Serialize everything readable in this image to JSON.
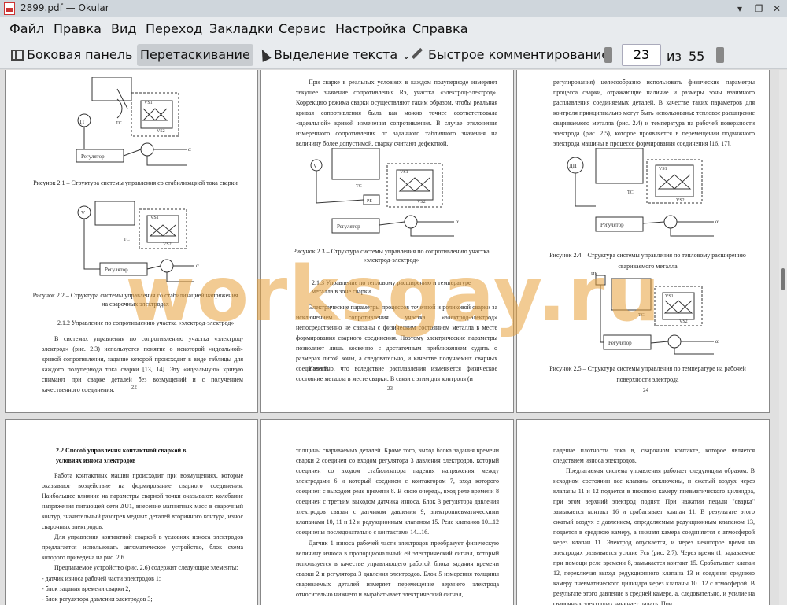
{
  "window": {
    "title": "2899.pdf — Okular",
    "controls": [
      "▾",
      "❐",
      "✕"
    ]
  },
  "menu": [
    "Файл",
    "Правка",
    "Вид",
    "Переход",
    "Закладки",
    "Сервис",
    "Настройка",
    "Справка"
  ],
  "toolbar": {
    "sidebar_label": "Боковая панель",
    "drag_label": "Перетаскивание",
    "select_label": "Выделение текста",
    "select_arrow": "⌄",
    "comment_label": "Быстрое комментирование",
    "current_page": "23",
    "of_label": "из",
    "total_pages": "55"
  },
  "watermark": "worksgay.ru",
  "pages": {
    "p22": {
      "fig21_caption": "Рисунок 2.1 – Структура системы управления со стабилизацией тока сварки",
      "fig22_caption": "Рисунок 2.2 – Структура системы управления со стабилизацией напряжения на сварочных электродах",
      "section": "2.1.2 Управление по сопротивлению участка «электрод-электрод»",
      "para": "В системах управления по сопротивлению участка «электрод-электрод» (рис. 2.3) используется понятие о некоторой «идеальной» кривой сопротивления, задание которой происходит в виде таблицы для каждого полупериода тока сварки [13, 14]. Эту «идеальную» кривую снимают при сварке деталей без возмущений и с получением качественного соединения.",
      "num": "22"
    },
    "p23": {
      "para1": "При сварке в реальных условиях в каждом полупериоде измеряют текущее значение сопротивления Rэ, участка «электрод-электрод». Коррекцию режима сварки осуществляют таким образом, чтобы реальная кривая сопротивления была как можно точнее соответствовала «идеальной» кривой изменения сопротивления. В случае отклонения измеренного сопротивления от заданного табличного значения на величину более допустимой, сварку считают дефектной.",
      "fig23_caption": "Рисунок 2.3 – Структура системы управления по сопротивлению участка «электрод-электрод»",
      "section": "2.1.3 Управление по тепловому расширению и температуре металла в зоне сварки",
      "para2": "Электрические параметры процессов точечной и роликовой сварки за исключением сопротивления участка «электрод-электрод» непосредственно не связаны с физическим состоянием металла в месте формирования сварного соединения. Поэтому электрические параметры позволяют лишь косвенно с достаточным приближением судить о размерах литой зоны, а следовательно, и качестве получаемых сварных соединений.",
      "para3": "Известно, что вследствие расплавления изменяется физическое состояние металла в месте сварки. В связи с этим для контроля (и",
      "num": "23"
    },
    "p24": {
      "para1": "регулирования) целесообразно использовать физические параметры процесса сварки, отражающие наличие и размеры зоны взаимного расплавления соединяемых деталей. В качестве таких параметров для контроля принципиально могут быть использованы: тепловое расширение свариваемого металла (рис. 2.4) и температура на рабочей поверхности электрода (рис. 2.5), которое проявляется в перемещении подвижного электрода машины в процессе формирования соединения [16, 17].",
      "fig24_caption": "Рисунок 2.4 – Структура системы управления по тепловому расширению свариваемого металла",
      "fig25_caption": "Рисунок 2.5 – Структура системы управления по температуре на рабочей поверхности электрода",
      "num": "24"
    },
    "p25": {
      "heading": "2.2 Способ управления контактной сваркой в условиях износа электродов",
      "para1": "Работа контактных машин происходит при возмущениях, которые оказывают воздействие на формирование сварного соединения. Наибольшее влияние на параметры сварной точки оказывают: колебание напряжения питающей сети ΔU1, внесение магнитных масс в сварочный контур, значительный разогрев медных деталей вторичного контура, износ сварочных электродов.",
      "para2": "Для управления контактной сваркой в условиях износа электродов предлагается использовать автоматическое устройство, блок схема которого приведена на рис. 2.6.",
      "para3": "Предлагаемое устройство (рис. 2.6) содержит следующие элементы:",
      "list": [
        "- датчик износа рабочей части электродов 1;",
        "- блок задания времени сварки 2;",
        "- блок регулятора давления электродов 3;"
      ]
    },
    "p26": {
      "para1": "толщины свариваемых деталей. Кроме того, выход блока задания времени сварки 2 соединен со входом регулятора 3 давления электродов, который соединен со входом стабилизатора падения напряжения между электродами 6 и который соединен с контактором 7, вход которого соединен с выходом реле времени 8. В свою очередь, вход реле времени 8 соединен с третьим выходом датчика износа. Блок 3 регулятора давления электродов связан с датчиком давления 9, электропневматическими клапанами 10, 11 и 12 и редукционным клапаном 15. Реле клапанов 10...12 соединены последовательно с контактами 14...16.",
      "para2": "Датчик 1 износа рабочей части электродов преобразует физическую величину износа в пропорциональный ей электрический сигнал, который используется в качестве управляющего работой блока задания времени сварки 2 и регулятора 3 давления электродов. Блок 5 измерения толщины свариваемых деталей измеряет перемещение верхнего электрода относительно нижнего и вырабатывает электрический сигнал,"
    },
    "p27": {
      "para1": "падение плотности тока в, сварочном контакте, которое является следствием износа электродов.",
      "para2": "Предлагаемая система управления работает следующим образом. В исходном состоянии все клапаны отключены, и сжатый воздух через клапаны 11 и 12 подается в нижнюю камеру пневматического цилиндра, при этом верхний электрод поднят. При нажатии педали \"сварка\" замыкается контакт 16 и срабатывает клапан 11. В результате этого сжатый воздух с давлением, определяемым редукционным клапаном 13, подается в среднюю камеру, а нижняя камера соединяется с атмосферой через клапан 11. Электрод опускается, и через некоторое время на электродах развивается усилие Fсв (рис. 2.7). Через время t1, задаваемое при помощи реле времени 8, замыкается контакт 15. Срабатывает клапан 12, переключая выход редукционного клапана 13 и соединяя среднюю камеру пневматического цилиндра через клапаны 10...12 с атмосферой. В результате этого давление в средней камере, а, следовательно, и усилие на сварочных электродах начинает падать. При"
    }
  }
}
